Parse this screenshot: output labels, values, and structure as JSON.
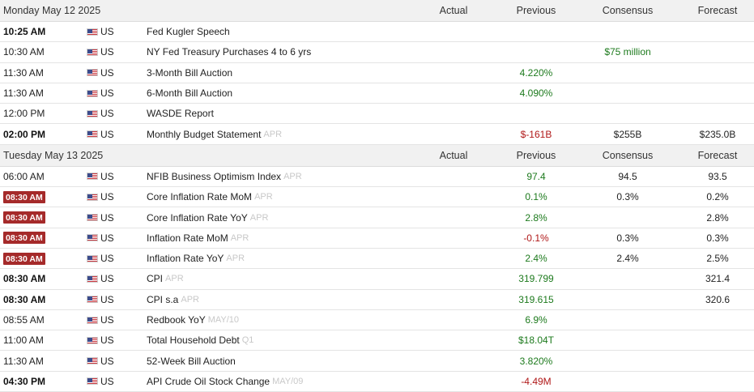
{
  "columns": {
    "actual": "Actual",
    "previous": "Previous",
    "consensus": "Consensus",
    "forecast": "Forecast"
  },
  "days": [
    {
      "date": "Monday May 12 2025",
      "events": [
        {
          "time": "10:25 AM",
          "time_style": "bold",
          "country": "US",
          "event": "Fed Kugler Speech",
          "ref": "",
          "actual": "",
          "previous": "",
          "previous_color": "",
          "consensus": "",
          "consensus_color": "",
          "forecast": ""
        },
        {
          "time": "10:30 AM",
          "time_style": "normal",
          "country": "US",
          "event": "NY Fed Treasury Purchases 4 to 6 yrs",
          "ref": "",
          "actual": "",
          "previous": "",
          "previous_color": "",
          "consensus": "$75 million",
          "consensus_color": "green",
          "forecast": ""
        },
        {
          "time": "11:30 AM",
          "time_style": "normal",
          "country": "US",
          "event": "3-Month Bill Auction",
          "ref": "",
          "actual": "",
          "previous": "4.220%",
          "previous_color": "green",
          "consensus": "",
          "consensus_color": "",
          "forecast": ""
        },
        {
          "time": "11:30 AM",
          "time_style": "normal",
          "country": "US",
          "event": "6-Month Bill Auction",
          "ref": "",
          "actual": "",
          "previous": "4.090%",
          "previous_color": "green",
          "consensus": "",
          "consensus_color": "",
          "forecast": ""
        },
        {
          "time": "12:00 PM",
          "time_style": "normal",
          "country": "US",
          "event": "WASDE Report",
          "ref": "",
          "actual": "",
          "previous": "",
          "previous_color": "",
          "consensus": "",
          "consensus_color": "",
          "forecast": ""
        },
        {
          "time": "02:00 PM",
          "time_style": "bold",
          "country": "US",
          "event": "Monthly Budget Statement",
          "ref": "APR",
          "actual": "",
          "previous": "$-161B",
          "previous_color": "red",
          "consensus": "$255B",
          "consensus_color": "plain",
          "forecast": "$235.0B"
        }
      ]
    },
    {
      "date": "Tuesday May 13 2025",
      "events": [
        {
          "time": "06:00 AM",
          "time_style": "normal",
          "country": "US",
          "event": "NFIB Business Optimism Index",
          "ref": "APR",
          "actual": "",
          "previous": "97.4",
          "previous_color": "green",
          "consensus": "94.5",
          "consensus_color": "plain",
          "forecast": "93.5"
        },
        {
          "time": "08:30 AM",
          "time_style": "badge",
          "country": "US",
          "event": "Core Inflation Rate MoM",
          "ref": "APR",
          "actual": "",
          "previous": "0.1%",
          "previous_color": "green",
          "consensus": "0.3%",
          "consensus_color": "plain",
          "forecast": "0.2%"
        },
        {
          "time": "08:30 AM",
          "time_style": "badge",
          "country": "US",
          "event": "Core Inflation Rate YoY",
          "ref": "APR",
          "actual": "",
          "previous": "2.8%",
          "previous_color": "green",
          "consensus": "",
          "consensus_color": "",
          "forecast": "2.8%"
        },
        {
          "time": "08:30 AM",
          "time_style": "badge",
          "country": "US",
          "event": "Inflation Rate MoM",
          "ref": "APR",
          "actual": "",
          "previous": "-0.1%",
          "previous_color": "red",
          "consensus": "0.3%",
          "consensus_color": "plain",
          "forecast": "0.3%"
        },
        {
          "time": "08:30 AM",
          "time_style": "badge",
          "country": "US",
          "event": "Inflation Rate YoY",
          "ref": "APR",
          "actual": "",
          "previous": "2.4%",
          "previous_color": "green",
          "consensus": "2.4%",
          "consensus_color": "plain",
          "forecast": "2.5%"
        },
        {
          "time": "08:30 AM",
          "time_style": "bold",
          "country": "US",
          "event": "CPI",
          "ref": "APR",
          "actual": "",
          "previous": "319.799",
          "previous_color": "green",
          "consensus": "",
          "consensus_color": "",
          "forecast": "321.4"
        },
        {
          "time": "08:30 AM",
          "time_style": "bold",
          "country": "US",
          "event": "CPI s.a",
          "ref": "APR",
          "actual": "",
          "previous": "319.615",
          "previous_color": "green",
          "consensus": "",
          "consensus_color": "",
          "forecast": "320.6"
        },
        {
          "time": "08:55 AM",
          "time_style": "normal",
          "country": "US",
          "event": "Redbook YoY",
          "ref": "MAY/10",
          "actual": "",
          "previous": "6.9%",
          "previous_color": "green",
          "consensus": "",
          "consensus_color": "",
          "forecast": ""
        },
        {
          "time": "11:00 AM",
          "time_style": "normal",
          "country": "US",
          "event": "Total Household Debt",
          "ref": "Q1",
          "actual": "",
          "previous": "$18.04T",
          "previous_color": "green",
          "consensus": "",
          "consensus_color": "",
          "forecast": ""
        },
        {
          "time": "11:30 AM",
          "time_style": "normal",
          "country": "US",
          "event": "52-Week Bill Auction",
          "ref": "",
          "actual": "",
          "previous": "3.820%",
          "previous_color": "green",
          "consensus": "",
          "consensus_color": "",
          "forecast": ""
        },
        {
          "time": "04:30 PM",
          "time_style": "bold",
          "country": "US",
          "event": "API Crude Oil Stock Change",
          "ref": "MAY/09",
          "actual": "",
          "previous": "-4.49M",
          "previous_color": "red",
          "consensus": "",
          "consensus_color": "",
          "forecast": ""
        }
      ]
    }
  ]
}
